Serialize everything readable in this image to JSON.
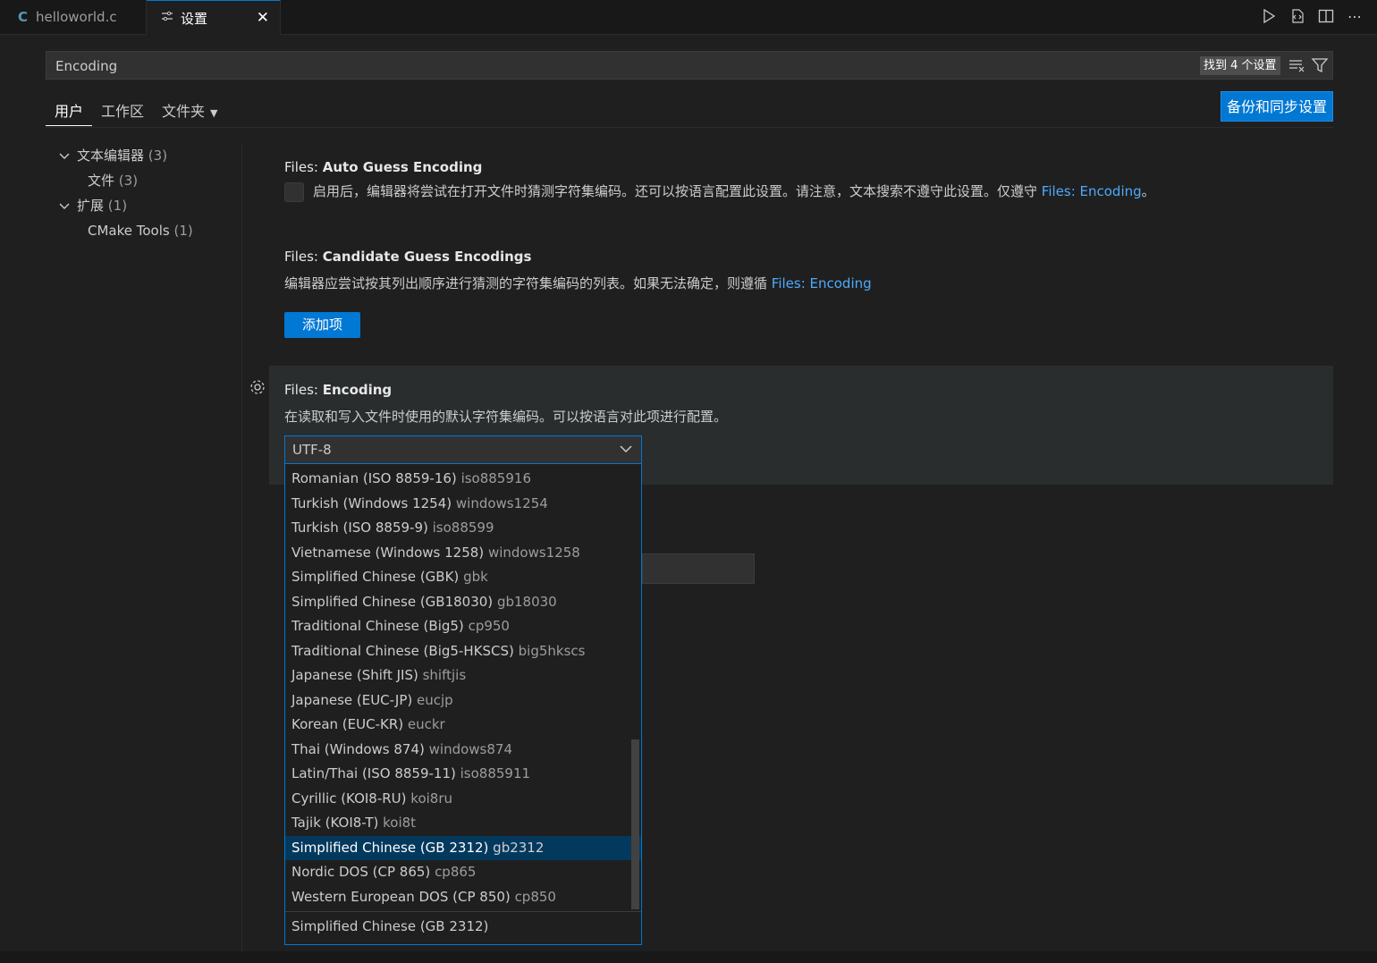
{
  "tabs": [
    {
      "icon": "C",
      "label": "helloworld.c"
    },
    {
      "icon": "settings-icon",
      "label": "设置"
    }
  ],
  "search": {
    "value": "Encoding",
    "result_count": "找到 4 个设置"
  },
  "scopes": [
    "用户",
    "工作区",
    "文件夹"
  ],
  "sync_button": "备份和同步设置",
  "toc": [
    {
      "label": "文本编辑器",
      "count": "(3)",
      "expanded": true,
      "level": 0
    },
    {
      "label": "文件",
      "count": "(3)",
      "level": 1
    },
    {
      "label": "扩展",
      "count": "(1)",
      "expanded": true,
      "level": 0
    },
    {
      "label": "CMake Tools",
      "count": "(1)",
      "level": 1
    }
  ],
  "settings": {
    "auto_guess": {
      "category": "Files: ",
      "name": "Auto Guess Encoding",
      "desc": "启用后，编辑器将尝试在打开文件时猜测字符集编码。还可以按语言配置此设置。请注意，文本搜索不遵守此设置。仅遵守 ",
      "link": "Files: Encoding",
      "desc_end": "。"
    },
    "candidate": {
      "category": "Files: ",
      "name": "Candidate Guess Encodings",
      "desc": "编辑器应尝试按其列出顺序进行猜测的字符集编码的列表。如果无法确定，则遵循 ",
      "link": "Files: Encoding",
      "button": "添加项"
    },
    "encoding": {
      "category": "Files: ",
      "name": "Encoding",
      "desc": "在读取和写入文件时使用的默认字符集编码。可以按语言对此项进行配置。",
      "value": "UTF-8"
    }
  },
  "dropdown": {
    "options": [
      {
        "label": "Romanian (ISO 8859-16)",
        "code": "iso885916"
      },
      {
        "label": "Turkish (Windows 1254)",
        "code": "windows1254"
      },
      {
        "label": "Turkish (ISO 8859-9)",
        "code": "iso88599"
      },
      {
        "label": "Vietnamese (Windows 1258)",
        "code": "windows1258"
      },
      {
        "label": "Simplified Chinese (GBK)",
        "code": "gbk"
      },
      {
        "label": "Simplified Chinese (GB18030)",
        "code": "gb18030"
      },
      {
        "label": "Traditional Chinese (Big5)",
        "code": "cp950"
      },
      {
        "label": "Traditional Chinese (Big5-HKSCS)",
        "code": "big5hkscs"
      },
      {
        "label": "Japanese (Shift JIS)",
        "code": "shiftjis"
      },
      {
        "label": "Japanese (EUC-JP)",
        "code": "eucjp"
      },
      {
        "label": "Korean (EUC-KR)",
        "code": "euckr"
      },
      {
        "label": "Thai (Windows 874)",
        "code": "windows874"
      },
      {
        "label": "Latin/Thai (ISO 8859-11)",
        "code": "iso885911"
      },
      {
        "label": "Cyrillic (KOI8-RU)",
        "code": "koi8ru"
      },
      {
        "label": "Tajik (KOI8-T)",
        "code": "koi8t"
      },
      {
        "label": "Simplified Chinese (GB 2312)",
        "code": "gb2312",
        "selected": true
      },
      {
        "label": "Nordic DOS (CP 865)",
        "code": "cp865"
      },
      {
        "label": "Western European DOS (CP 850)",
        "code": "cp850"
      }
    ],
    "description": "Simplified Chinese (GB 2312)"
  },
  "colors": {
    "accent": "#0078d4",
    "link": "#4daafc",
    "selection": "#04395e"
  }
}
